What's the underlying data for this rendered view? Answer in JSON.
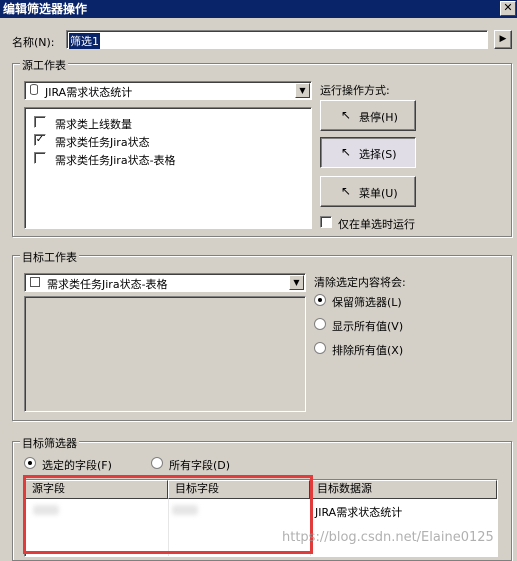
{
  "window": {
    "title": "编辑筛选器操作",
    "close": "x"
  },
  "name_row": {
    "label": "名称(N):",
    "value": "筛选1",
    "arrow": "▶"
  },
  "source_group": {
    "title": "源工作表",
    "combo_value": "JIRA需求状态统计",
    "sheets": [
      {
        "label": "需求类上线数量",
        "checked": false
      },
      {
        "label": "需求类任务Jira状态",
        "checked": true
      },
      {
        "label": "需求类任务Jira状态-表格",
        "checked": false
      }
    ],
    "run_label": "运行操作方式:",
    "run_buttons": [
      {
        "label": "悬停(H)",
        "pressed": false
      },
      {
        "label": "选择(S)",
        "pressed": true
      },
      {
        "label": "菜单(U)",
        "pressed": false
      }
    ],
    "single_run_label": "仅在单选时运行"
  },
  "target_group": {
    "title": "目标工作表",
    "combo_value": "需求类任务Jira状态-表格",
    "clear_label": "清除选定内容将会:",
    "options": [
      {
        "label": "保留筛选器(L)",
        "selected": true
      },
      {
        "label": "显示所有值(V)",
        "selected": false
      },
      {
        "label": "排除所有值(X)",
        "selected": false
      }
    ]
  },
  "filter_group": {
    "title": "目标筛选器",
    "options": [
      {
        "label": "选定的字段(F)",
        "selected": true
      },
      {
        "label": "所有字段(D)",
        "selected": false
      }
    ],
    "columns": [
      "源字段",
      "目标字段",
      "目标数据源"
    ],
    "rows": [
      {
        "target_source": "JIRA需求状态统计"
      }
    ]
  },
  "watermark": "https://blog.csdn.net/Elaine0125",
  "icons": [
    "close-icon",
    "arrow-right-icon",
    "chevron-down-icon",
    "database-icon",
    "chart-icon",
    "cursor-icon",
    "check-icon"
  ]
}
